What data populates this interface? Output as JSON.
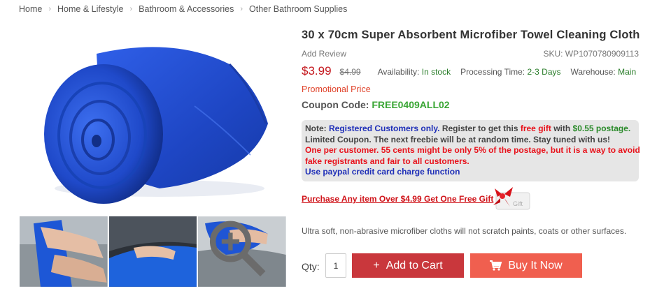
{
  "breadcrumb": {
    "items": [
      "Home",
      "Home & Lifestyle",
      "Bathroom & Accessories",
      "Other Bathroom Supplies"
    ]
  },
  "product": {
    "title": "30 x 70cm Super Absorbent Microfiber Towel Cleaning Cloth",
    "add_review": "Add Review",
    "sku": "SKU: WP1070780909113",
    "price": "$3.99",
    "old_price": "$4.99",
    "availability_label": "Availability:",
    "availability_value": "In stock",
    "processing_label": "Processing Time:",
    "processing_value": "2-3 Days",
    "warehouse_label": "Warehouse:",
    "warehouse_value": "Main",
    "promo": "Promotional Price",
    "coupon_label": "Coupon Code:",
    "coupon_code": "FREE0409ALL02",
    "description": "Ultra soft, non-abrasive microfiber cloths will not scratch paints, coats or other surfaces."
  },
  "note": {
    "l1_a": "Note: ",
    "l1_b": "Registered Customers only.",
    "l1_c": " Register to get this ",
    "l1_d": "free gift",
    "l1_e": " with ",
    "l1_f": "$0.55 postage.",
    "l2": "Limited Coupon. The next freebie will be at random time. Stay tuned with us!",
    "l3": "One per customer. 55 cents might be only 5% of the postage, but it is a way to avoid",
    "l4": "fake registrants and fair to all customers.",
    "l5": "Use paypal credit card charge function"
  },
  "gift": {
    "link": "Purchase Any item Over $4.99 Get One Free Gift",
    "tag_text": "Gift"
  },
  "purchase": {
    "qty_label": "Qty:",
    "qty_value": "1",
    "add_to_cart": "Add to Cart",
    "buy_now": "Buy It Now"
  },
  "icons": {
    "breadcrumb_sep": "chevron-right-icon",
    "add_to_cart": "plus-icon",
    "buy_now": "cart-icon",
    "zoom": "magnifier-icon"
  },
  "colors": {
    "price": "#c4161c",
    "coupon_code": "#3aa635",
    "add_to_cart_bg": "#c9373c",
    "buy_now_bg": "#f05f4f",
    "towel_blue": "#1f49c9"
  }
}
